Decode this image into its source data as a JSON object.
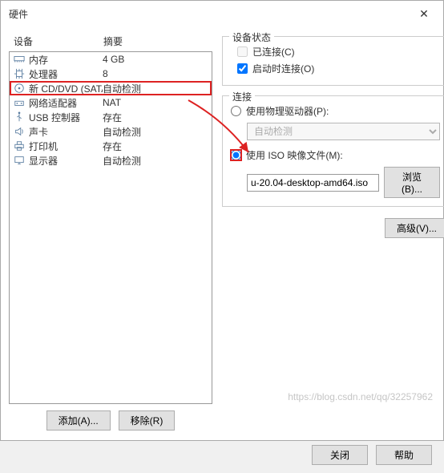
{
  "dialog": {
    "title": "硬件",
    "close": "✕"
  },
  "columns": {
    "device": "设备",
    "summary": "摘要"
  },
  "devices": [
    {
      "icon": "memory-icon",
      "name": "内存",
      "summary": "4 GB"
    },
    {
      "icon": "cpu-icon",
      "name": "处理器",
      "summary": "8"
    },
    {
      "icon": "cd-icon",
      "name": "新 CD/DVD (SATA)",
      "summary": "自动检测",
      "selected": true
    },
    {
      "icon": "network-icon",
      "name": "网络适配器",
      "summary": "NAT"
    },
    {
      "icon": "usb-icon",
      "name": "USB 控制器",
      "summary": "存在"
    },
    {
      "icon": "sound-icon",
      "name": "声卡",
      "summary": "自动检测"
    },
    {
      "icon": "printer-icon",
      "name": "打印机",
      "summary": "存在"
    },
    {
      "icon": "display-icon",
      "name": "显示器",
      "summary": "自动检测"
    }
  ],
  "left_buttons": {
    "add": "添加(A)...",
    "remove": "移除(R)"
  },
  "status": {
    "group": "设备状态",
    "connected": "已连接(C)",
    "connect_on_power": "启动时连接(O)",
    "connected_checked": false,
    "connect_on_power_checked": true
  },
  "connection": {
    "group": "连接",
    "use_physical": "使用物理驱动器(P):",
    "physical_value": "自动检测",
    "use_iso": "使用 ISO 映像文件(M):",
    "iso_value": "u-20.04-desktop-amd64.iso",
    "browse": "浏览(B)...",
    "selected": "iso"
  },
  "advanced": "高级(V)...",
  "footer": {
    "close": "关闭",
    "help": "帮助"
  },
  "watermark": "https://blog.csdn.net/qq/32257962"
}
